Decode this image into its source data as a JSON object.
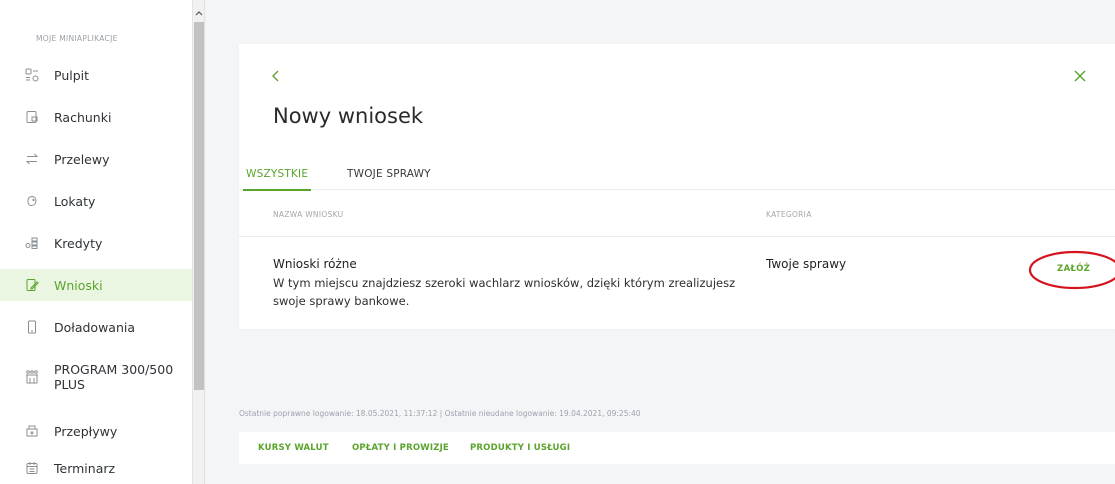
{
  "colors": {
    "accent": "#5aa42c",
    "active_bg": "#eaf6e2",
    "annotation": "#d6121c"
  },
  "sidebar": {
    "heading": "MOJE MINIAPLIKACJE",
    "items": [
      {
        "label": "Pulpit",
        "icon": "dashboard-icon"
      },
      {
        "label": "Rachunki",
        "icon": "account-icon"
      },
      {
        "label": "Przelewy",
        "icon": "transfer-icon"
      },
      {
        "label": "Lokaty",
        "icon": "deposit-icon"
      },
      {
        "label": "Kredyty",
        "icon": "credit-icon"
      },
      {
        "label": "Wnioski",
        "icon": "application-icon",
        "active": true
      },
      {
        "label": "Doładowania",
        "icon": "phone-icon"
      },
      {
        "label": "PROGRAM 300/500",
        "label2": "PLUS",
        "icon": "children-icon"
      },
      {
        "label": "Przepływy",
        "icon": "cashflow-icon"
      },
      {
        "label": "Terminarz",
        "icon": "calendar-icon"
      }
    ]
  },
  "card": {
    "title": "Nowy wniosek",
    "tabs": [
      {
        "label": "WSZYSTKIE",
        "active": true
      },
      {
        "label": "TWOJE SPRAWY"
      }
    ],
    "columns": {
      "name": "NAZWA WNIOSKU",
      "category": "KATEGORIA"
    },
    "rows": [
      {
        "title": "Wnioski różne",
        "description": "W tym miejscu znajdziesz szeroki wachlarz wniosków, dzięki którym zrealizujesz swoje sprawy bankowe.",
        "category": "Twoje sprawy",
        "action": "ZAŁÓŻ"
      }
    ]
  },
  "footer": {
    "login_info": "Ostatnie poprawne logowanie: 18.05.2021, 11:37:12  |  Ostatnie nieudane logowanie: 19.04.2021, 09:25:40",
    "links": [
      "KURSY WALUT",
      "OPŁATY I PROWIZJE",
      "PRODUKTY I USŁUGI"
    ]
  }
}
